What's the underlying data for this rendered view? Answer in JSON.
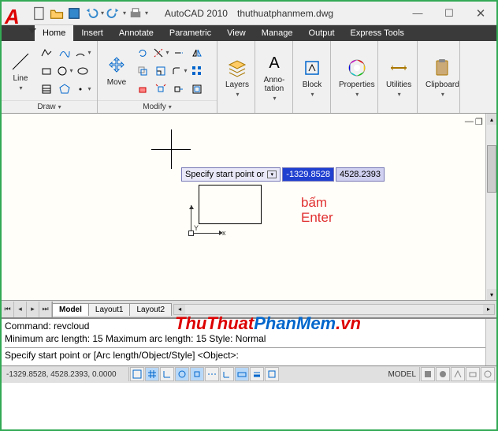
{
  "titlebar": {
    "app_name": "AutoCAD 2010",
    "file_name": "thuthuatphanmem.dwg"
  },
  "app_menu_letter": "A",
  "tabs": [
    "Home",
    "Insert",
    "Annotate",
    "Parametric",
    "View",
    "Manage",
    "Output",
    "Express Tools"
  ],
  "active_tab": 0,
  "ribbon": {
    "draw": {
      "title": "Draw",
      "line_label": "Line"
    },
    "modify": {
      "title": "Modify",
      "move_label": "Move"
    },
    "layers": {
      "label": "Layers"
    },
    "annotation": {
      "label": "Anno-\ntation"
    },
    "block": {
      "label": "Block"
    },
    "properties": {
      "label": "Properties"
    },
    "utilities": {
      "label": "Utilities"
    },
    "clipboard": {
      "label": "Clipboard"
    }
  },
  "canvas": {
    "dyn_prompt": "Specify start point or",
    "dyn_x": "-1329.8528",
    "dyn_y": "4528.2393",
    "annotation_line1": "bấm",
    "annotation_line2": "Enter",
    "ucs_x": "x",
    "ucs_y": "Y"
  },
  "layout_tabs": [
    "Model",
    "Layout1",
    "Layout2"
  ],
  "active_layout": 0,
  "command": {
    "line1": "Command: revcloud",
    "line2": "Minimum arc length: 15   Maximum arc length: 15   Style: Normal",
    "input": "Specify start point or [Arc length/Object/Style] <Object>:"
  },
  "status": {
    "coords": "-1329.8528, 4528.2393, 0.0000",
    "model_label": "MODEL"
  },
  "watermark": {
    "p1": "ThuThuat",
    "p2": "PhanMem",
    "p3": ".vn"
  }
}
